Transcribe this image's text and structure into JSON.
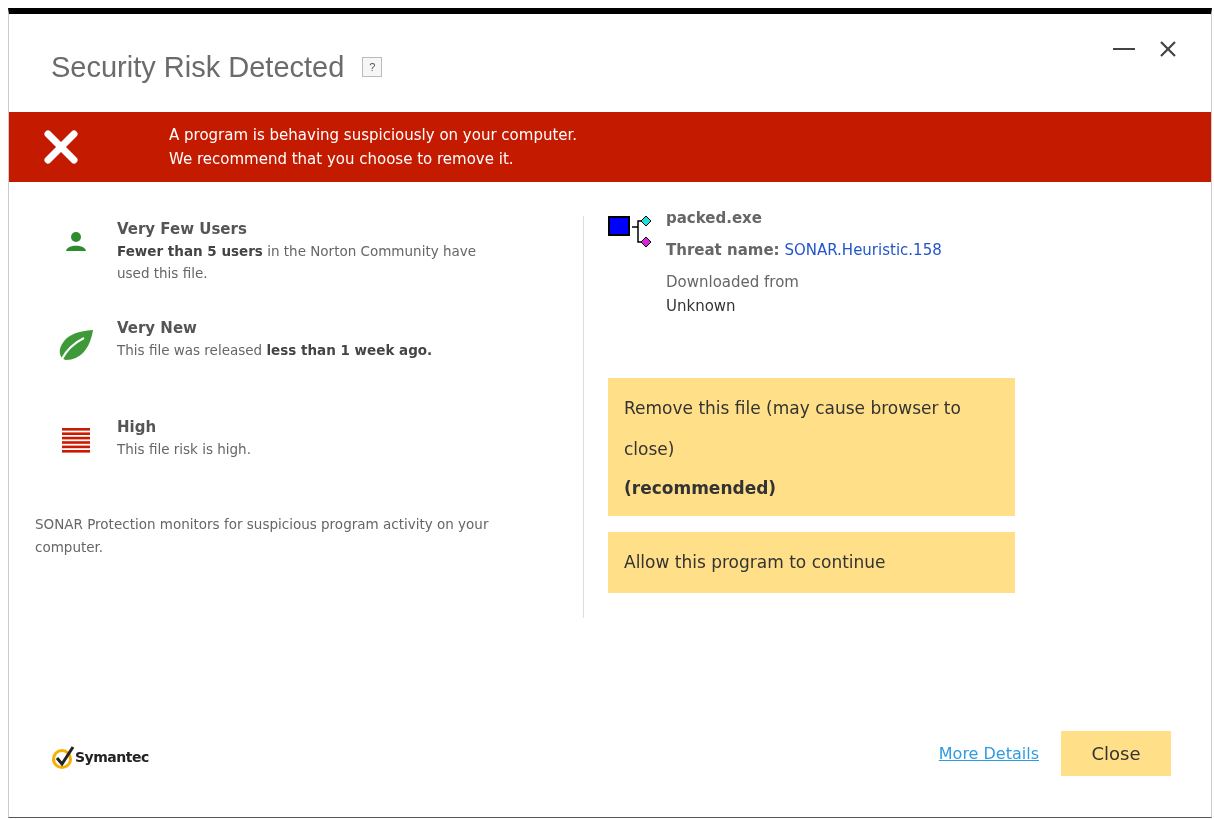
{
  "window": {
    "title": "Security Risk Detected",
    "help_label": "?"
  },
  "banner": {
    "lines": [
      "A program is behaving suspiciously on your computer.",
      "We recommend that you choose to remove it."
    ]
  },
  "factors": [
    {
      "kind": "users",
      "title": "Very Few Users",
      "description": "**Fewer than 5 users** in the Norton Community have used this file."
    },
    {
      "kind": "age",
      "title": "Very New",
      "description": "This file was released **less than 1 week ago.**"
    },
    {
      "kind": "risk",
      "title": "High",
      "description": "This file risk is high."
    }
  ],
  "note": "SONAR Protection monitors for suspicious program activity on your computer.",
  "file": {
    "name": "packed.exe",
    "threat_label": "Threat name:",
    "threat_name": "SONAR.Heuristic.158",
    "source_label": "Downloaded from",
    "source": "Unknown"
  },
  "actions": [
    {
      "label": "Remove this file (may cause browser to close)",
      "note": "(recommended)"
    },
    {
      "label": "Allow this program to continue"
    }
  ],
  "footer": {
    "logo": "Symantec",
    "more_details": "More Details",
    "close": "Close"
  }
}
